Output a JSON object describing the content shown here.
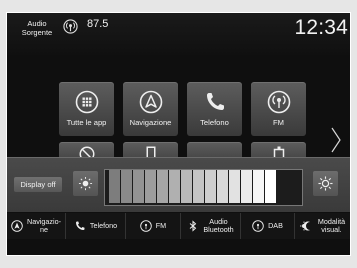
{
  "status_bar": {
    "source_label": "Audio\nSorgente",
    "frequency": "87.5",
    "clock": "12:34"
  },
  "home_tiles": [
    {
      "label": "Tutte le app",
      "icon": "apps-grid-icon"
    },
    {
      "label": "Navigazione",
      "icon": "navigation-arrow-icon"
    },
    {
      "label": "Telefono",
      "icon": "phone-icon"
    },
    {
      "label": "FM",
      "icon": "fm-radio-icon"
    }
  ],
  "brightness": {
    "display_off_label": "Display off",
    "decrease_icon": "brightness-low-icon",
    "increase_icon": "brightness-high-icon",
    "level_fraction": 1.0,
    "segment_colors": [
      "#7d7d7d",
      "#8a8a8a",
      "#939393",
      "#9d9d9d",
      "#a6a6a6",
      "#b0b0b0",
      "#bababa",
      "#c4c4c4",
      "#cecece",
      "#d8d8d8",
      "#e2e2e2",
      "#ececec",
      "#f6f6f6",
      "#ffffff"
    ]
  },
  "bottom_nav": [
    {
      "label": "Navigazio-\nne",
      "icon": "navigation-arrow-icon"
    },
    {
      "label": "Telefono",
      "icon": "phone-icon"
    },
    {
      "label": "FM",
      "icon": "fm-radio-icon"
    },
    {
      "label": "Audio\nBluetooth",
      "icon": "bluetooth-icon"
    },
    {
      "label": "DAB",
      "icon": "dab-radio-icon"
    },
    {
      "label": "Modalità\nvisual.",
      "icon": "display-mode-icon"
    }
  ],
  "colors": {
    "screen_bg": "#0f0f0f",
    "tile_top": "#5d5d5d",
    "tile_bottom": "#3a3a3a",
    "text": "#f2f2f2"
  }
}
